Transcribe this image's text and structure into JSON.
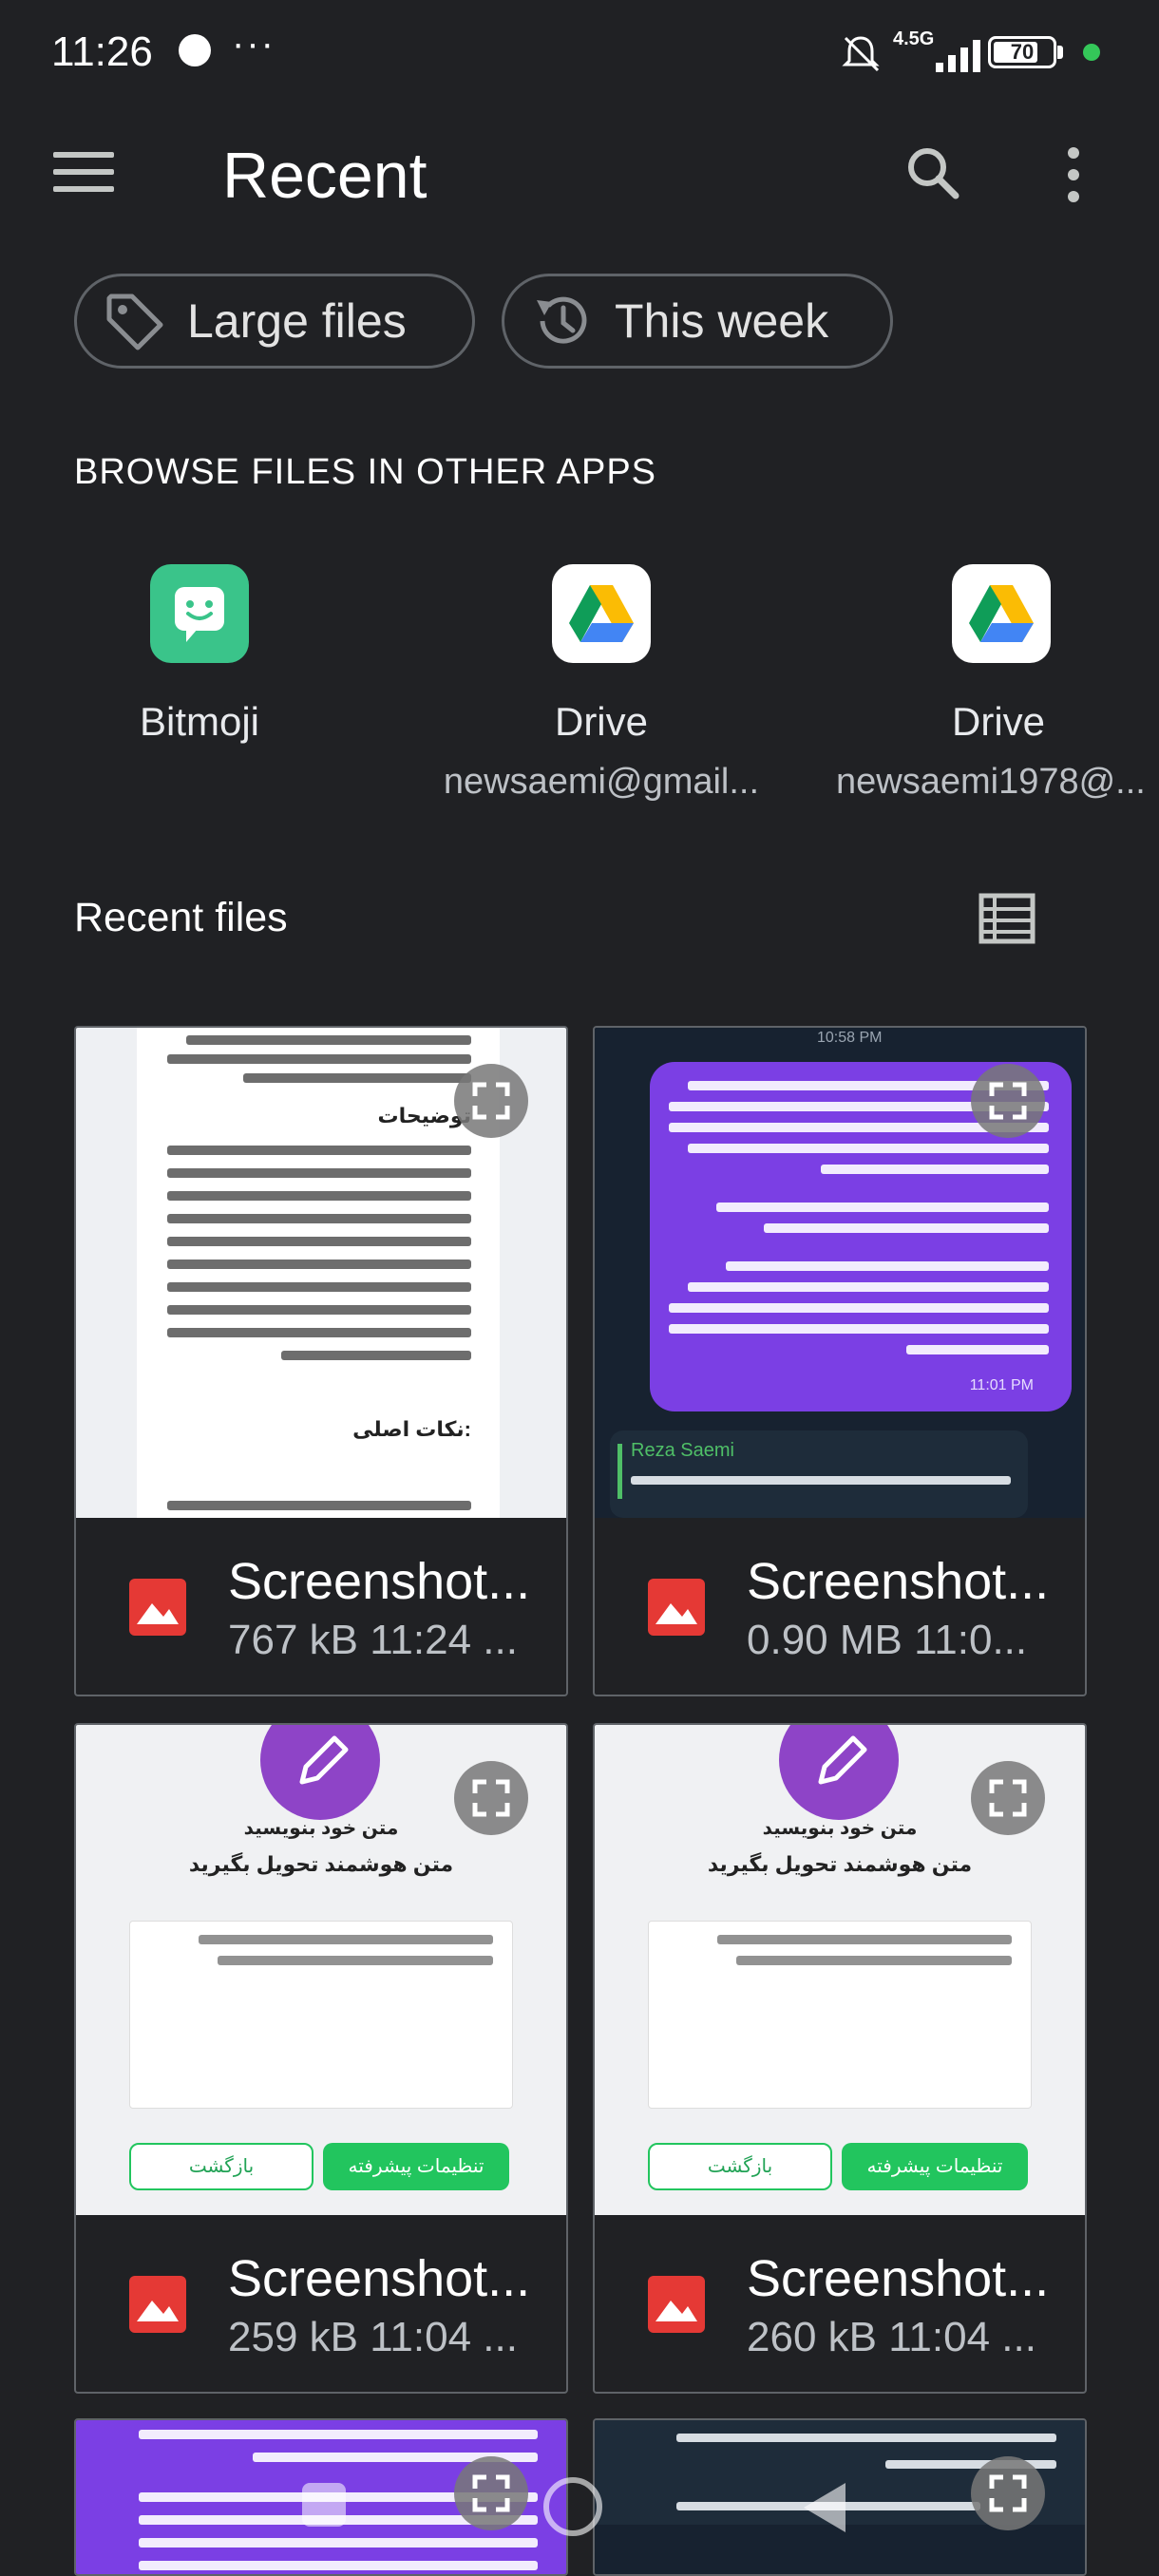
{
  "status": {
    "time": "11:26",
    "more": "···",
    "network": "4.5G",
    "battery": "70"
  },
  "appbar": {
    "title": "Recent"
  },
  "chips": [
    {
      "label": "Large files",
      "icon": "tag-icon"
    },
    {
      "label": "This week",
      "icon": "history-icon"
    }
  ],
  "browse": {
    "title": "BROWSE FILES IN OTHER APPS",
    "apps": [
      {
        "name": "Bitmoji",
        "sub": "",
        "icon": "bitmoji-icon"
      },
      {
        "name": "Drive",
        "sub": "newsaemi@gmail...",
        "icon": "google-drive-icon"
      },
      {
        "name": "Drive",
        "sub": "newsaemi1978@...",
        "icon": "google-drive-icon"
      }
    ]
  },
  "recent": {
    "title": "Recent files",
    "files": [
      {
        "name": "Screenshot...",
        "meta": "767 kB 11:24 ..."
      },
      {
        "name": "Screenshot...",
        "meta": "0.90 MB 11:0..."
      },
      {
        "name": "Screenshot...",
        "meta": "259 kB 11:04 ..."
      },
      {
        "name": "Screenshot...",
        "meta": "260 kB 11:04 ..."
      }
    ],
    "thumb_text": {
      "doc_heading": "توضیحات",
      "doc_heading2": "نکات اصلی:",
      "chat_reply_name": "Reza Saemi",
      "chat_time1": "10:58 PM",
      "chat_time2": "11:01 PM",
      "form_title1": "متن خود بنویسید",
      "form_title2": "متن هوشمند تحویل بگیرید",
      "form_btn_primary": "تنظیمات پیشرفته",
      "form_btn_secondary": "بازگشت"
    }
  },
  "colors": {
    "background": "#202124",
    "image_icon": "#e53935",
    "bitmoji": "#3ac48a",
    "chat_bubble": "#7b3fe4",
    "form_button": "#22c55e"
  }
}
